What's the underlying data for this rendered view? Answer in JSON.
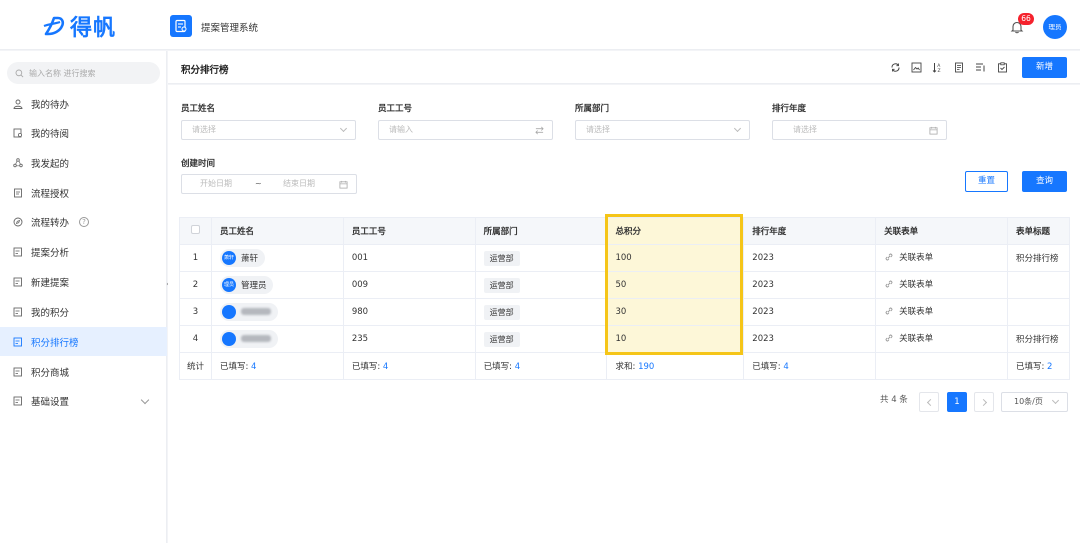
{
  "brand": {
    "logo_text": "得帆"
  },
  "header": {
    "app_title": "提案管理系统",
    "notification_count": "66",
    "user_avatar": "理员"
  },
  "sidebar": {
    "search_placeholder": "输入名称 进行搜索",
    "items": [
      {
        "label": "我的待办",
        "icon": "user-icon"
      },
      {
        "label": "我的待阅",
        "icon": "doc-view-icon"
      },
      {
        "label": "我发起的",
        "icon": "share-icon"
      },
      {
        "label": "流程授权",
        "icon": "doc-icon"
      },
      {
        "label": "流程转办",
        "icon": "compass-icon",
        "help": "?"
      },
      {
        "label": "提案分析",
        "icon": "report-icon"
      },
      {
        "label": "新建提案",
        "icon": "report-icon"
      },
      {
        "label": "我的积分",
        "icon": "report-icon"
      },
      {
        "label": "积分排行榜",
        "icon": "report-icon",
        "active": true
      },
      {
        "label": "积分商城",
        "icon": "report-icon"
      },
      {
        "label": "基础设置",
        "icon": "report-icon",
        "expandable": true
      }
    ]
  },
  "page": {
    "title": "积分排行榜",
    "new_button": "新增",
    "reset_button": "重置",
    "query_button": "查询"
  },
  "filters": {
    "employee_name": {
      "label": "员工姓名",
      "placeholder": "请选择"
    },
    "employee_id": {
      "label": "员工工号",
      "placeholder": "请输入"
    },
    "department": {
      "label": "所属部门",
      "placeholder": "请选择"
    },
    "ranking_year": {
      "label": "排行年度",
      "placeholder": "请选择"
    },
    "created_time": {
      "label": "创建时间",
      "start_placeholder": "开始日期",
      "separator": "~",
      "end_placeholder": "结束日期"
    }
  },
  "table": {
    "columns": [
      "员工姓名",
      "员工工号",
      "所属部门",
      "总积分",
      "排行年度",
      "关联表单",
      "表单标题"
    ],
    "rows": [
      {
        "index": "1",
        "avatar": "萧轩",
        "name": "萧轩",
        "emp_id": "001",
        "dept": "运营部",
        "points": "100",
        "year": "2023",
        "link": "关联表单",
        "form_title": "积分排行榜",
        "blurred": false
      },
      {
        "index": "2",
        "avatar": "理员",
        "name": "管理员",
        "emp_id": "009",
        "dept": "运营部",
        "points": "50",
        "year": "2023",
        "link": "关联表单",
        "form_title": "",
        "blurred": false
      },
      {
        "index": "3",
        "avatar": "",
        "name": "",
        "emp_id": "980",
        "dept": "运营部",
        "points": "30",
        "year": "2023",
        "link": "关联表单",
        "form_title": "",
        "blurred": true
      },
      {
        "index": "4",
        "avatar": "",
        "name": "",
        "emp_id": "235",
        "dept": "运营部",
        "points": "10",
        "year": "2023",
        "link": "关联表单",
        "form_title": "积分排行榜",
        "blurred": true
      }
    ],
    "footer": {
      "label": "统计",
      "name": {
        "prefix": "已填写: ",
        "value": "4"
      },
      "emp_id": {
        "prefix": "已填写: ",
        "value": "4"
      },
      "dept": {
        "prefix": "已填写: ",
        "value": "4"
      },
      "points": {
        "prefix": "求和: ",
        "value": "190"
      },
      "year": {
        "prefix": "已填写: ",
        "value": "4"
      },
      "form_title": {
        "prefix": "已填写: ",
        "value": "2"
      }
    }
  },
  "pagination": {
    "total": "共 4 条",
    "current_page": "1",
    "page_size": "10条/页"
  },
  "colors": {
    "primary": "#1677ff",
    "highlight_frame": "#f5c518",
    "badge": "#f5222d"
  }
}
